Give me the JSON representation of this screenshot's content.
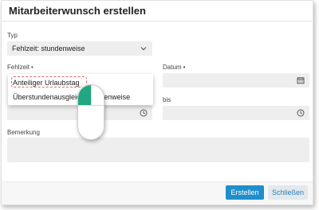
{
  "dialog": {
    "title": "Mitarbeiterwunsch erstellen"
  },
  "form": {
    "typ_label": "Typ",
    "typ_value": "Fehlzeit: stundenweise",
    "fehlzeit_label": "Fehlzeit",
    "fehlzeit_required": "•",
    "datum_label": "Datum",
    "datum_required": "•",
    "bis_label": "bis",
    "bemerkung_label": "Bemerkung"
  },
  "dropdown": {
    "options": [
      "Anteiliger Urlaubstag",
      "Überstundenausgleich stundenweise"
    ],
    "highlighted": "Anteiliger Urlaubstag"
  },
  "footer": {
    "create_label": "Erstellen",
    "close_label": "Schließen"
  },
  "colors": {
    "primary": "#1e8fcc",
    "highlight_border": "#d86a6a",
    "mouse_button": "#23a682"
  },
  "icons": {
    "typ": "chevron-down-icon",
    "datum": "calendar-icon",
    "time": "clock-icon"
  }
}
